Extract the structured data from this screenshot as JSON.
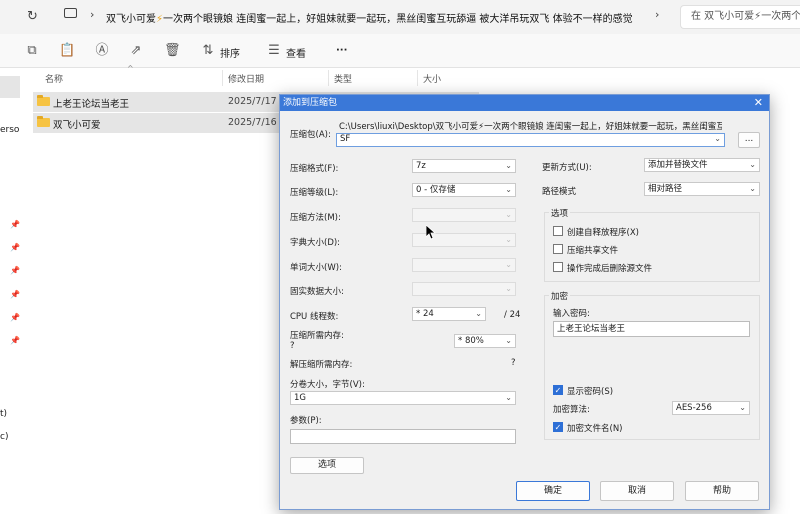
{
  "address": {
    "path": [
      "双飞小可爱",
      "一次两个眼镜娘 连闺蜜一起上，好姐妹就要一起玩，黑丝闺蜜互玩舔逼 被大洋吊玩双飞 体验不一样的感觉"
    ],
    "path_leading": "双飞小可爱",
    "path_emoji": "⚡",
    "search_placeholder": "在 双飞小可爱⚡一次两个"
  },
  "toolbar": {
    "sort_label": "排序",
    "view_label": "查看",
    "more_label": "···"
  },
  "columns": {
    "name": "名称",
    "date": "修改日期",
    "type": "类型",
    "size": "大小"
  },
  "left_pane_fragments": [
    "erso",
    "t)",
    "c)"
  ],
  "files": [
    {
      "name": "上老王论坛当老王",
      "date": "2025/7/17 1"
    },
    {
      "name": "双飞小可爱",
      "date": "2025/7/16 8"
    }
  ],
  "dialog": {
    "title": "添加到压缩包",
    "archive_label": "压缩包(A):",
    "archive_path": "C:\\Users\\liuxi\\Desktop\\双飞小可爱⚡一次两个眼镜娘 连闺蜜一起上，好姐妹就要一起玩，黑丝闺蜜互玩舔逼 被",
    "archive_path_line2": "SF",
    "browse_label": "...",
    "format_label": "压缩格式(F):",
    "format_value": "7z",
    "level_label": "压缩等级(L):",
    "level_value": "0 - 仅存储",
    "method_label": "压缩方法(M):",
    "dict_label": "字典大小(D):",
    "word_label": "单词大小(W):",
    "solid_label": "固实数据大小:",
    "threads_label": "CPU 线程数:",
    "threads_value": "* 24",
    "threads_max": "/ 24",
    "mem_comp_label": "压缩所需内存:",
    "mem_comp_q": "?",
    "mem_comp_value": "* 80%",
    "mem_decomp_label": "解压缩所需内存:",
    "mem_decomp_q": "?",
    "split_label": "分卷大小，字节(V):",
    "split_value": "1G",
    "params_label": "参数(P):",
    "params_value": "",
    "options_button": "选项",
    "update_label": "更新方式(U):",
    "update_value": "添加并替换文件",
    "pathmode_label": "路径模式",
    "pathmode_value": "相对路径",
    "options_group": "选项",
    "opt_sfx": "创建自释放程序(X)",
    "opt_shared": "压缩共享文件",
    "opt_delete": "操作完成后删除源文件",
    "encrypt_group": "加密",
    "password_label": "输入密码:",
    "password_value": "上老王论坛当老王",
    "show_password": "显示密码(S)",
    "enc_method_label": "加密算法:",
    "enc_method_value": "AES-256",
    "enc_names": "加密文件名(N)",
    "ok": "确定",
    "cancel": "取消",
    "help": "帮助"
  }
}
